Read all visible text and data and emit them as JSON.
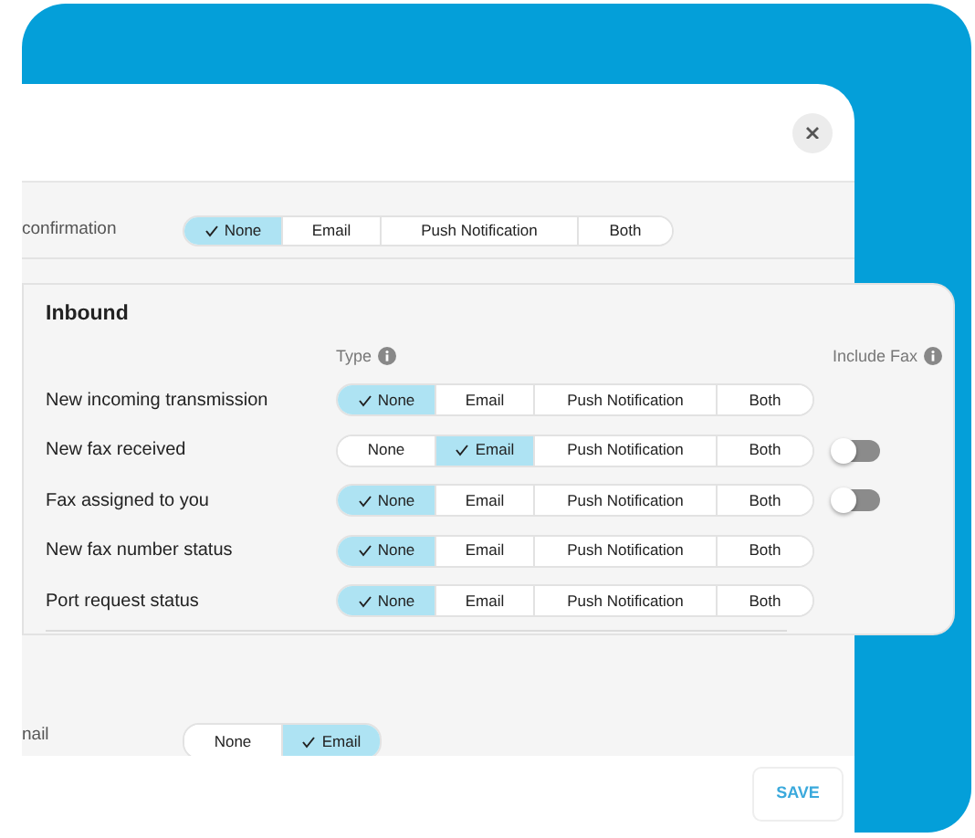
{
  "modal": {
    "upper_row": {
      "label": "confirmation",
      "options": [
        {
          "label": "None",
          "selected": true
        },
        {
          "label": "Email",
          "selected": false
        },
        {
          "label": "Push Notification",
          "selected": false
        },
        {
          "label": "Both",
          "selected": false
        }
      ]
    },
    "lower_row": {
      "label": "nail",
      "options": [
        {
          "label": "None",
          "selected": false
        },
        {
          "label": "Email",
          "selected": true
        }
      ]
    },
    "save_button": "SAVE"
  },
  "inbound": {
    "title": "Inbound",
    "columns": [
      "Type",
      "Include Fax"
    ],
    "rows": [
      {
        "label": "New incoming transmission",
        "options": [
          {
            "label": "None",
            "selected": true
          },
          {
            "label": "Email",
            "selected": false
          },
          {
            "label": "Push Notification",
            "selected": false
          },
          {
            "label": "Both",
            "selected": false
          }
        ]
      },
      {
        "label": "New fax received",
        "options": [
          {
            "label": "None",
            "selected": false
          },
          {
            "label": "Email",
            "selected": true
          },
          {
            "label": "Push Notification",
            "selected": false
          },
          {
            "label": "Both",
            "selected": false
          }
        ],
        "include_fax": {
          "on": false
        }
      },
      {
        "label": "Fax assigned to you",
        "options": [
          {
            "label": "None",
            "selected": true
          },
          {
            "label": "Email",
            "selected": false
          },
          {
            "label": "Push Notification",
            "selected": false
          },
          {
            "label": "Both",
            "selected": false
          }
        ],
        "include_fax": {
          "on": false
        }
      },
      {
        "label": "New fax number status",
        "options": [
          {
            "label": "None",
            "selected": true
          },
          {
            "label": "Email",
            "selected": false
          },
          {
            "label": "Push Notification",
            "selected": false
          },
          {
            "label": "Both",
            "selected": false
          }
        ]
      },
      {
        "label": "Port request status",
        "options": [
          {
            "label": "None",
            "selected": true
          },
          {
            "label": "Email",
            "selected": false
          },
          {
            "label": "Push Notification",
            "selected": false
          },
          {
            "label": "Both",
            "selected": false
          }
        ]
      }
    ]
  }
}
